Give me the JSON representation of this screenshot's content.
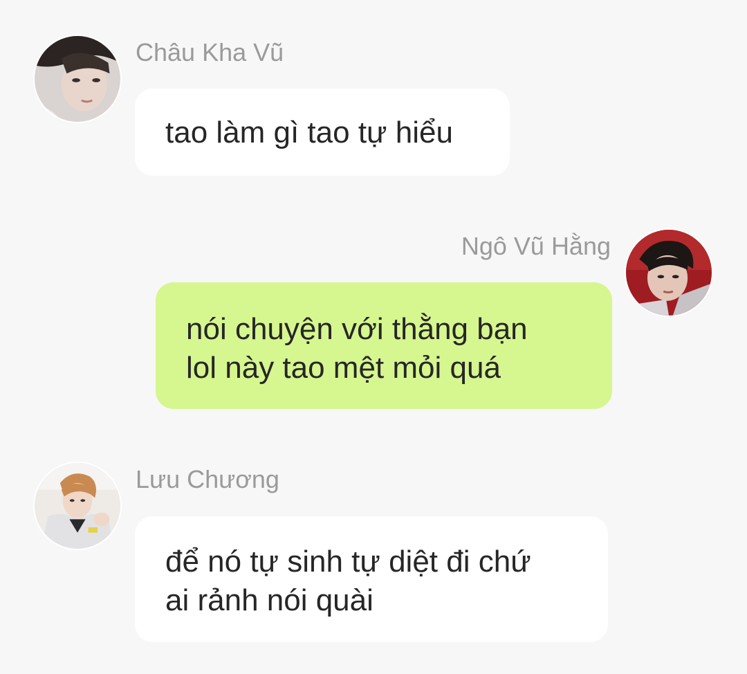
{
  "chat": {
    "messages": [
      {
        "sender": "Châu Kha Vũ",
        "direction": "incoming",
        "lines": [
          "tao làm gì tao tự hiểu"
        ]
      },
      {
        "sender": "Ngô Vũ Hằng",
        "direction": "outgoing",
        "lines": [
          "nói chuyện với thằng bạn",
          "lol này tao mệt mỏi quá"
        ]
      },
      {
        "sender": "Lưu Chương",
        "direction": "incoming",
        "lines": [
          "để nó tự sinh tự diệt đi chứ",
          "ai rảnh nói quài"
        ]
      }
    ]
  },
  "colors": {
    "background": "#f7f7f7",
    "incoming_bubble": "#ffffff",
    "outgoing_bubble": "#d6f68f",
    "sender_name": "#9a9a9a",
    "message_text": "#262626"
  }
}
